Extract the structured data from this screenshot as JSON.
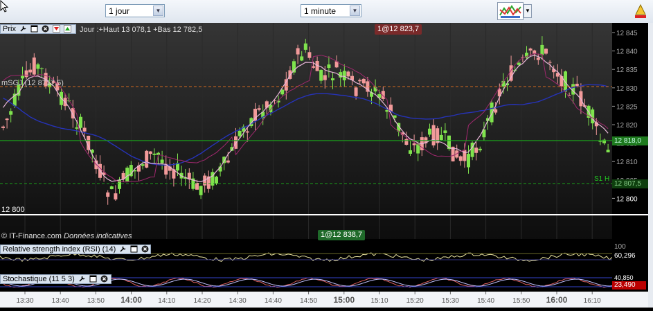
{
  "toolbar": {
    "period_select": "1 jour",
    "interval_select": "1 minute"
  },
  "main_panel": {
    "header_label": "Prix",
    "info": "Jour :+Haut 13 078,1 +Bas 12 782,5",
    "indicator_label": "mSGJ (12 8717,5)",
    "top_marker": "1@12 823,7",
    "bottom_marker": "1@12 838,7",
    "level_label": "12 800",
    "copyright": "© IT-Finance.com",
    "disclaimer": "Données indicatives",
    "price_ticks": [
      "12 845",
      "12 840",
      "12 835",
      "12 830",
      "12 825",
      "12 820",
      "12 815",
      "12 810",
      "12 805",
      "12 800"
    ],
    "current_price_tag": "12 818,0",
    "support_tag": "12 807,5",
    "support_label": "S1 H"
  },
  "rsi_panel": {
    "header_label": "Relative strength index (RSI) (14)",
    "value": "60,296",
    "tick": "100"
  },
  "stoch_panel": {
    "header_label": "Stochastique (11 5 3)",
    "value_top": "40,850",
    "value_bottom": "23,490"
  },
  "time_axis": [
    "13:30",
    "13:40",
    "13:50",
    "14:00",
    "14:10",
    "14:20",
    "14:30",
    "14:40",
    "14:50",
    "15:00",
    "15:10",
    "15:20",
    "15:30",
    "15:40",
    "15:50",
    "16:00",
    "16:10"
  ],
  "time_axis_bold": [
    "14:00",
    "15:00",
    "16:00"
  ],
  "colors": {
    "up_candle": "#7fe34d",
    "down_candle": "#f29a9a",
    "ma_long": "#2633b8",
    "ma_short": "#e8b6d9",
    "bollinger": "#a0286e",
    "current_line": "#1aa31a",
    "resistance_line": "#d2691e"
  }
}
